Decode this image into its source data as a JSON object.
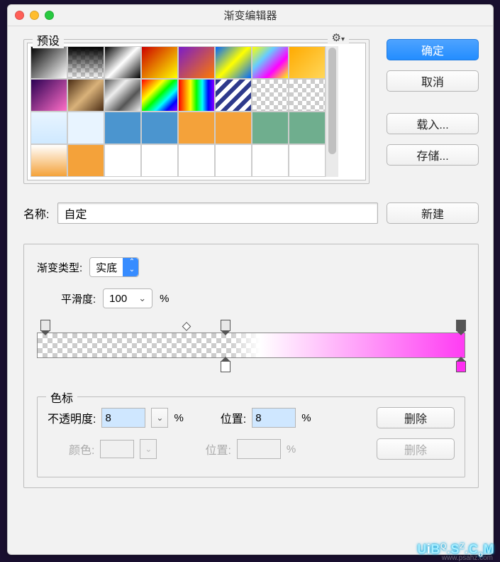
{
  "window": {
    "title": "渐变编辑器"
  },
  "presets": {
    "legend": "预设",
    "gear": "✿₊"
  },
  "side": {
    "ok": "确定",
    "cancel": "取消",
    "load": "载入...",
    "save": "存储..."
  },
  "name": {
    "label": "名称:",
    "value": "自定",
    "new_btn": "新建"
  },
  "gradient": {
    "type_label": "渐变类型:",
    "type_value": "实底",
    "smooth_label": "平滑度:",
    "smooth_value": "100",
    "smooth_unit": "%"
  },
  "stops": {
    "legend": "色标",
    "opacity_label": "不透明度:",
    "opacity_value": "8",
    "opacity_unit": "%",
    "pos1_label": "位置:",
    "pos1_value": "8",
    "pos1_unit": "%",
    "delete1": "删除",
    "color_label": "颜色:",
    "pos2_label": "位置:",
    "pos2_value": "",
    "pos2_unit": "%",
    "delete2": "删除"
  },
  "watermark": {
    "text": "UiB .S .C M",
    "sub": "www.psahz.com"
  }
}
